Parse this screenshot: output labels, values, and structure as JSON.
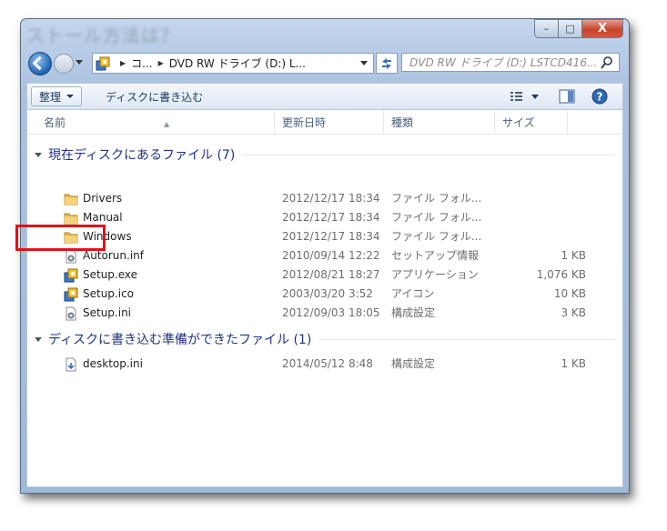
{
  "window": {
    "blurred_title": "ストール方法は？",
    "controls": {
      "minimize": "–",
      "maximize": "□",
      "close": "X"
    }
  },
  "nav": {
    "address_parts": [
      "コ...",
      "DVD RW ドライブ (D:) L..."
    ],
    "search_placeholder": "DVD RW ドライブ (D:) LSTCD416..."
  },
  "toolbar": {
    "organize_label": "整理",
    "burn_label": "ディスクに書き込む"
  },
  "columns": [
    "名前",
    "更新日時",
    "種類",
    "サイズ"
  ],
  "groups": [
    {
      "label": "現在ディスクにあるファイル (7)",
      "items": [
        {
          "name": "Drivers",
          "date": "2012/12/17 18:34",
          "type": "ファイル フォル...",
          "size": "",
          "icon": "folder-icon"
        },
        {
          "name": "Manual",
          "date": "2012/12/17 18:34",
          "type": "ファイル フォル...",
          "size": "",
          "icon": "folder-icon"
        },
        {
          "name": "Windows",
          "date": "2012/12/17 18:34",
          "type": "ファイル フォル...",
          "size": "",
          "icon": "folder-icon"
        },
        {
          "name": "Autorun.inf",
          "date": "2010/09/14 12:22",
          "type": "セットアップ情報",
          "size": "1 KB",
          "icon": "settings-file-icon"
        },
        {
          "name": "Setup.exe",
          "date": "2012/08/21 18:27",
          "type": "アプリケーション",
          "size": "1,076 KB",
          "icon": "setup-app-icon"
        },
        {
          "name": "Setup.ico",
          "date": "2003/03/20 3:52",
          "type": "アイコン",
          "size": "10 KB",
          "icon": "setup-app-icon"
        },
        {
          "name": "Setup.ini",
          "date": "2012/09/03 18:05",
          "type": "構成設定",
          "size": "3 KB",
          "icon": "settings-file-icon"
        }
      ]
    },
    {
      "label": "ディスクに書き込む準備ができたファイル (1)",
      "items": [
        {
          "name": "desktop.ini",
          "date": "2014/05/12 8:48",
          "type": "構成設定",
          "size": "1 KB",
          "icon": "pending-file-icon"
        }
      ]
    }
  ],
  "colors": {
    "highlight": "#e0121b",
    "group_text": "#1e3287",
    "chrome": "#b6cbe6"
  }
}
